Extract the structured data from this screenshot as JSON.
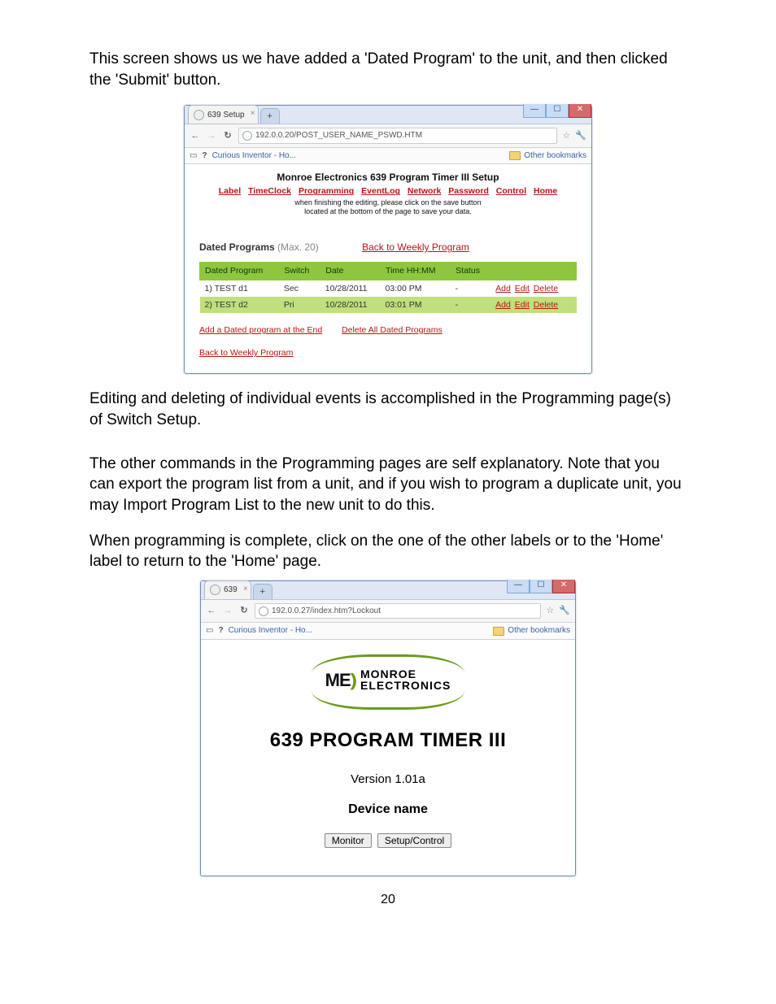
{
  "para1": "This screen shows us we have added a 'Dated Program' to the unit, and then clicked the 'Submit' button.",
  "scr1": {
    "tab_title": "639 Setup",
    "url": "192.0.0.20/POST_USER_NAME_PSWD.HTM",
    "bookmark_item": "Curious Inventor - Ho...",
    "other_bookmarks": "Other bookmarks",
    "setup_title": "Monroe Electronics 639 Program Timer III Setup",
    "menu": [
      "Label",
      "TimeClock",
      "Programming",
      "EventLog",
      "Network",
      "Password",
      "Control",
      "Home"
    ],
    "note1": "when finishing the editing, please click on the save button",
    "note2": "located at the bottom of the page to save your data.",
    "sub_main": "Dated Programs",
    "sub_muted": "(Max. 20)",
    "sub_link": "Back to Weekly Program",
    "cols": [
      "Dated Program",
      "Switch",
      "Date",
      "Time HH:MM",
      "Status",
      ""
    ],
    "rows": [
      {
        "name": "1) TEST d1",
        "switch": "Sec",
        "date": "10/28/2011",
        "time": "03:00 PM",
        "status": "-",
        "sel": false
      },
      {
        "name": "2) TEST d2",
        "switch": "Pri",
        "date": "10/28/2011",
        "time": "03:01 PM",
        "status": "-",
        "sel": true
      }
    ],
    "row_actions": [
      "Add",
      "Edit",
      "Delete"
    ],
    "foot1": "Add a Dated program at the End",
    "foot2": "Delete All Dated Programs",
    "foot3": "Back to Weekly Program"
  },
  "para2": "Editing and deleting of individual events is accomplished in the Programming page(s) of Switch Setup.",
  "para3": "The other commands in the Programming pages are self explanatory.  Note that you can export the program list from a unit, and if you wish to program a duplicate unit, you may Import Program List to the new unit to do this.",
  "para4": "When programming is complete, click on the one of the other labels or to the 'Home' label to return to the 'Home' page.",
  "scr2": {
    "tab_title": "639",
    "url": "192.0.0.27/index.htm?Lockout",
    "bookmark_item": "Curious Inventor - Ho...",
    "other_bookmarks": "Other bookmarks",
    "brand1": "MONROE",
    "brand2": "ELECTRONICS",
    "h1": "639 PROGRAM TIMER III",
    "version": "Version 1.01a",
    "device": "Device name",
    "btn1": "Monitor",
    "btn2": "Setup/Control"
  },
  "page_number": "20"
}
